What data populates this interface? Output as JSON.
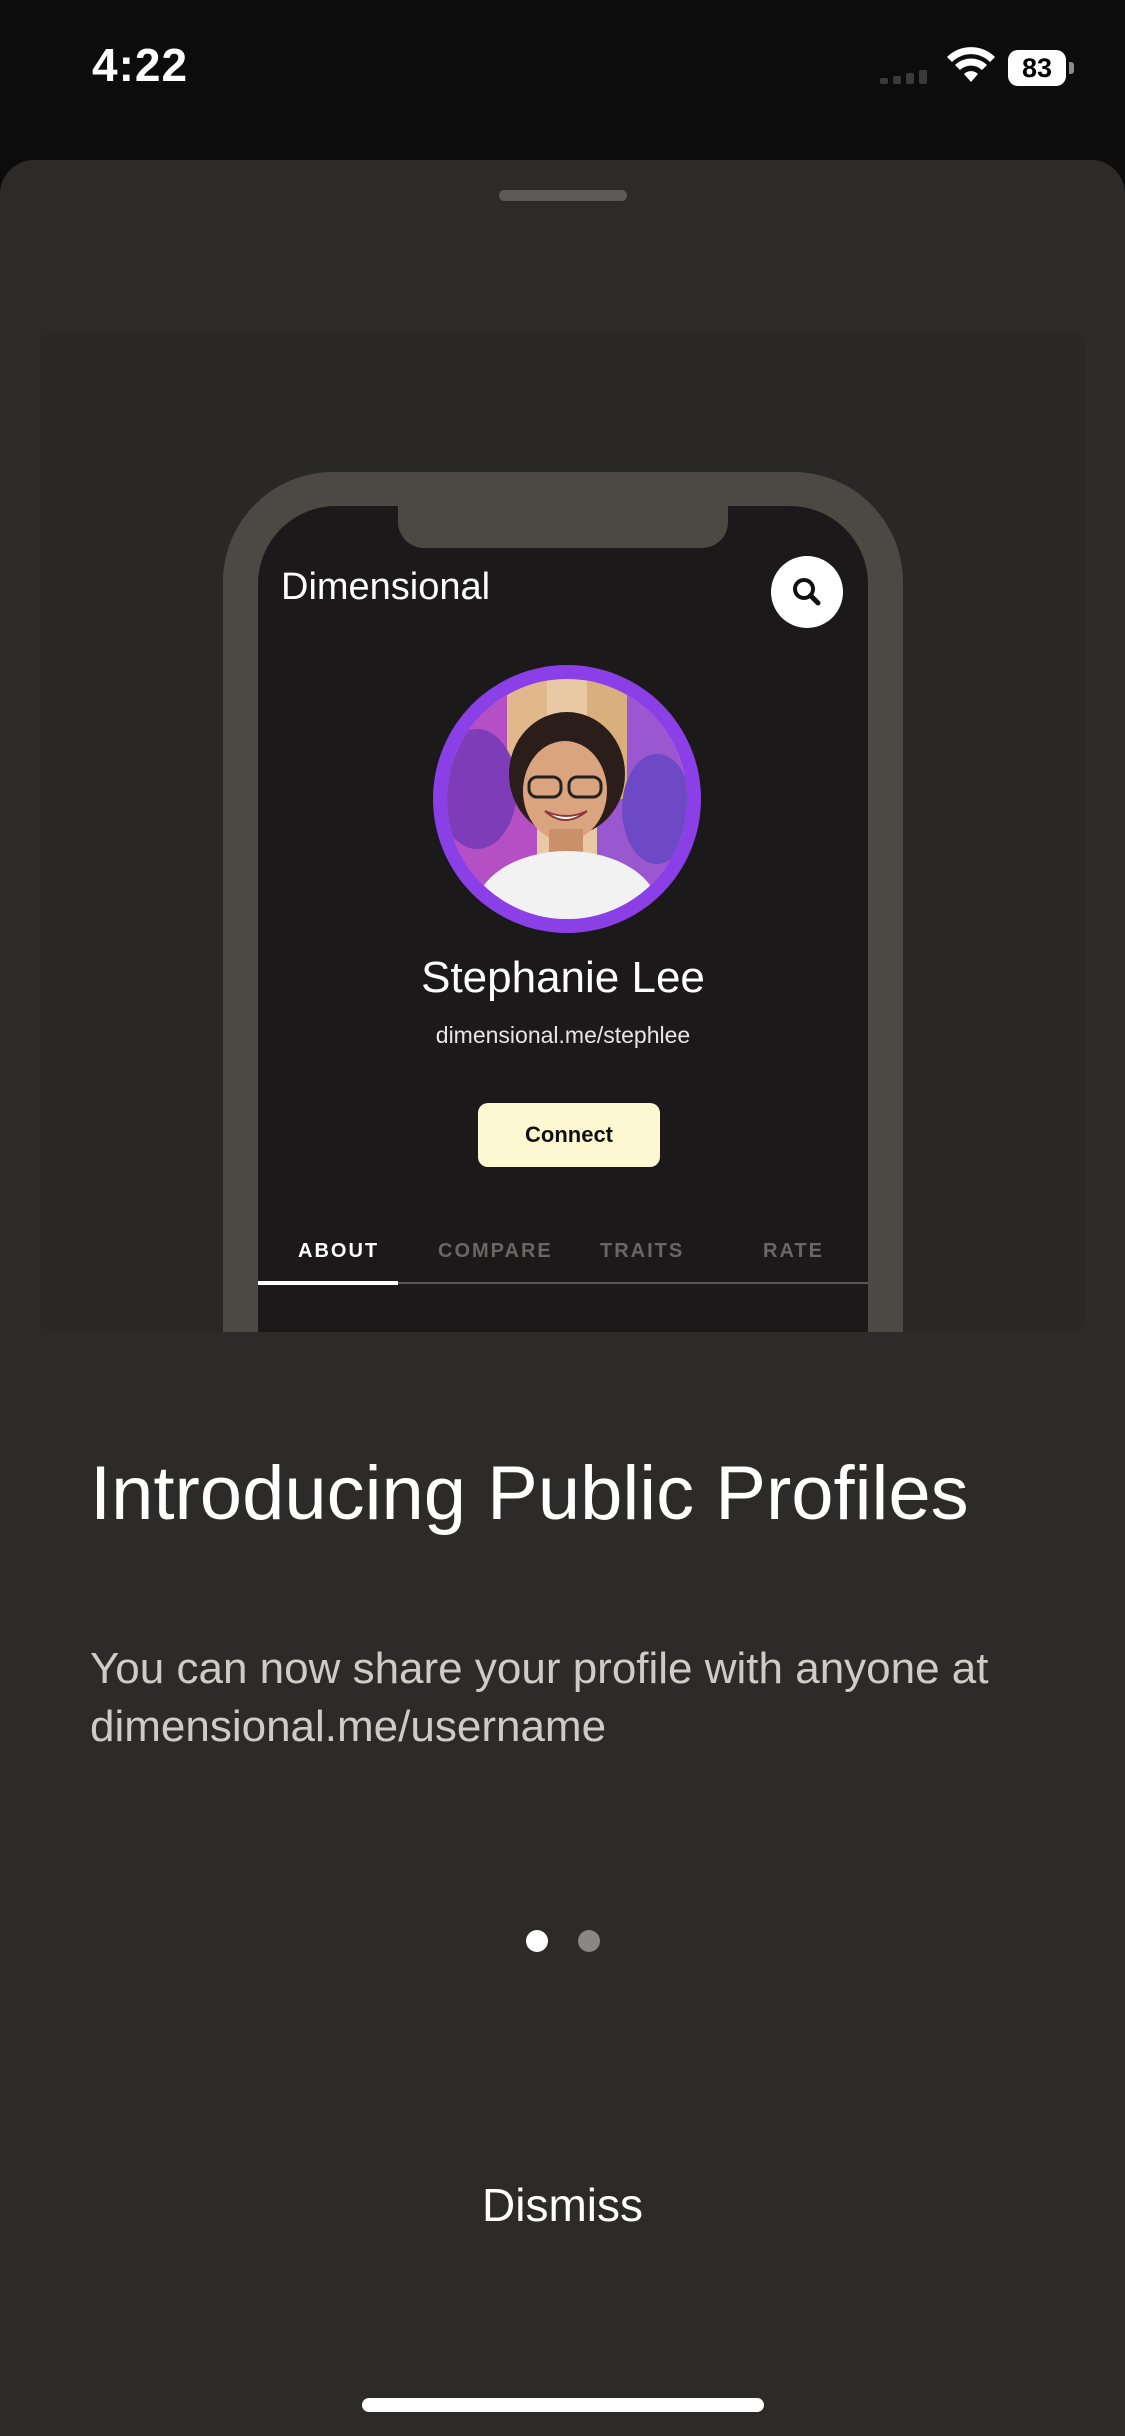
{
  "status_bar": {
    "time": "4:22",
    "battery_level": "83",
    "signal_icon": "signal-icon",
    "wifi_icon": "wifi-icon",
    "battery_icon": "battery-icon"
  },
  "preview": {
    "app_title": "Dimensional",
    "search_icon": "search-icon",
    "profile_name": "Stephanie Lee",
    "profile_url": "dimensional.me/stephlee",
    "connect_label": "Connect",
    "tabs": [
      {
        "label": "ABOUT",
        "active": true
      },
      {
        "label": "COMPARE",
        "active": false
      },
      {
        "label": "TRAITS",
        "active": false
      },
      {
        "label": "RATE",
        "active": false
      }
    ],
    "accent_color": "#8b3fe6"
  },
  "headline": "Introducing Public Profiles",
  "body": "You can now share your profile with anyone at dimensional.me/username",
  "pagination": {
    "current": 1,
    "total": 2,
    "active_color": "#ffffff",
    "inactive_color": "#8a8686"
  },
  "dismiss_label": "Dismiss"
}
